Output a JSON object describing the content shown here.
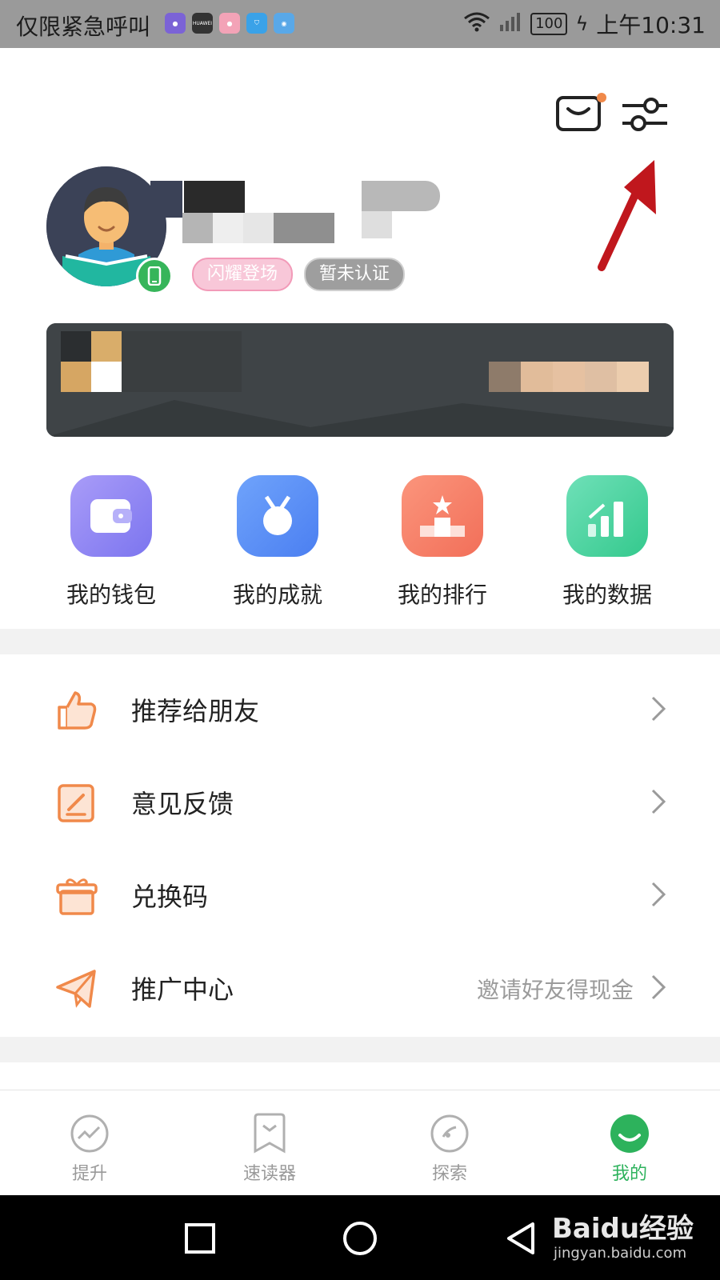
{
  "status_bar": {
    "carrier_text": "仅限紧急呼叫",
    "app_icons": [
      "app-icon-1",
      "huawei-icon",
      "app-icon-3",
      "shield-app-icon",
      "app-icon-5"
    ],
    "huawei_text": "HUAWEI",
    "battery": "100",
    "time": "上午10:31"
  },
  "header": {
    "mail_icon": "mail-icon",
    "settings_icon": "settings-sliders-icon"
  },
  "profile": {
    "tag_primary": "闪耀登场",
    "tag_secondary": "暂未认证"
  },
  "shortcuts": [
    {
      "label": "我的钱包",
      "icon": "wallet-icon",
      "color": "#8f86f4"
    },
    {
      "label": "我的成就",
      "icon": "medal-icon",
      "color": "#5c8ff6"
    },
    {
      "label": "我的排行",
      "icon": "podium-icon",
      "color": "#f7806a"
    },
    {
      "label": "我的数据",
      "icon": "chart-icon",
      "color": "#3fd49b"
    }
  ],
  "list": [
    {
      "label": "推荐给朋友",
      "icon": "thumbs-up-icon"
    },
    {
      "label": "意见反馈",
      "icon": "feedback-edit-icon"
    },
    {
      "label": "兑换码",
      "icon": "gift-icon"
    },
    {
      "label": "推广中心",
      "icon": "paper-plane-icon",
      "sub": "邀请好友得现金"
    }
  ],
  "tabs": [
    {
      "label": "提升",
      "icon": "trend-icon",
      "active": false
    },
    {
      "label": "速读器",
      "icon": "bookmark-icon",
      "active": false
    },
    {
      "label": "探索",
      "icon": "compass-icon",
      "active": false
    },
    {
      "label": "我的",
      "icon": "smile-profile-icon",
      "active": true
    }
  ],
  "colors": {
    "accent": "#2db25c",
    "list_icon": "#f0894a",
    "annotation_arrow": "#c0171d"
  },
  "watermark": {
    "brand": "Baidu经验",
    "url": "jingyan.baidu.com"
  }
}
